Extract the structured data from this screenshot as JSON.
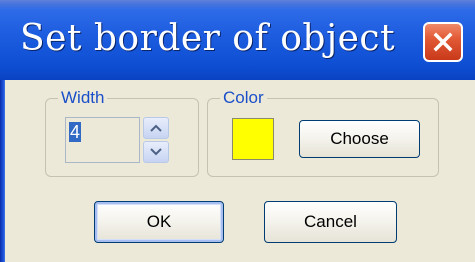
{
  "window": {
    "title": "Set border of object",
    "close_icon": "close-icon"
  },
  "width_group": {
    "legend": "Width",
    "value": "4"
  },
  "color_group": {
    "legend": "Color",
    "swatch_color": "#ffff00",
    "choose_label": "Choose"
  },
  "buttons": {
    "ok_label": "OK",
    "cancel_label": "Cancel"
  }
}
